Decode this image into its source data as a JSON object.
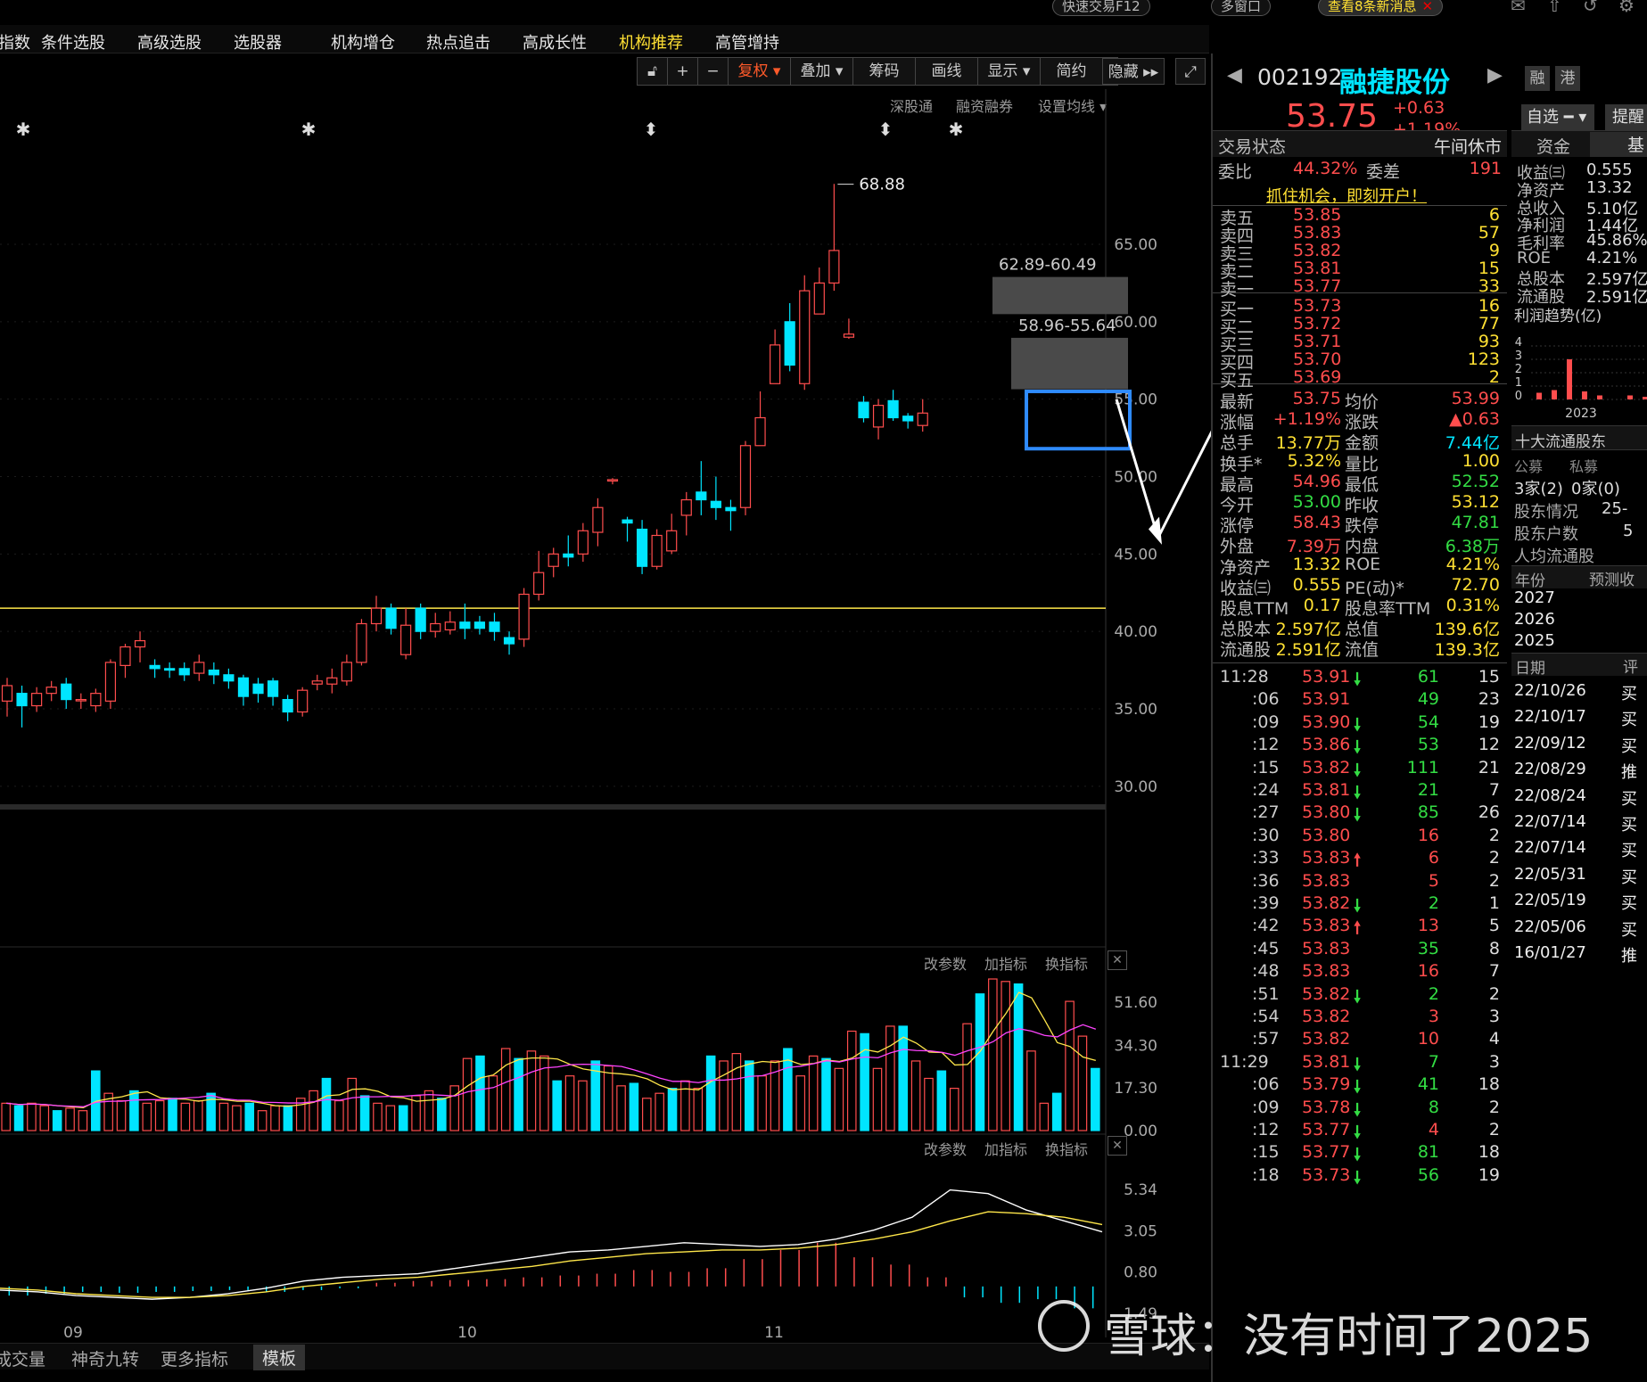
{
  "topbar": {
    "quick_trade": "快速交易F12",
    "multi_window": "多窗口",
    "news": "查看8条新消息"
  },
  "menu": [
    {
      "label": "指数",
      "x": -2
    },
    {
      "label": "条件选股",
      "x": 46
    },
    {
      "label": "高级选股",
      "x": 154
    },
    {
      "label": "选股器",
      "x": 262
    },
    {
      "label": "机构增仓",
      "x": 371
    },
    {
      "label": "热点追击",
      "x": 478
    },
    {
      "label": "高成长性",
      "x": 586
    },
    {
      "label": "机构推荐",
      "x": 694,
      "active": true
    },
    {
      "label": "高管增持",
      "x": 802
    }
  ],
  "chart_tools": [
    "复权",
    "叠加",
    "筹码",
    "画线",
    "显示",
    "简约",
    "隐藏"
  ],
  "chart_sub_links": [
    "深股通",
    "融资融券",
    "设置均线"
  ],
  "indicator_links": [
    "改参数",
    "加指标",
    "换指标"
  ],
  "bottom_tabs": [
    "成交量",
    "神奇九转",
    "更多指标",
    "模板"
  ],
  "chart_data": [
    {
      "type": "candlestick",
      "x_ticks": [
        "09",
        "10",
        "11"
      ],
      "ylim": [
        25.5,
        72.6
      ],
      "y_ticks": [
        "65.00",
        "60.00",
        "55.00",
        "50.00",
        "45.00",
        "40.00",
        "35.00",
        "30.00"
      ],
      "reference_line": 41.5,
      "annotations": {
        "high": "68.88",
        "zone1": "62.89-60.49",
        "zone2": "58.96-55.64"
      },
      "candles": [
        [
          35.5,
          36.5,
          34.5,
          37.0
        ],
        [
          36.0,
          35.2,
          33.8,
          36.5
        ],
        [
          35.2,
          36.0,
          34.8,
          36.4
        ],
        [
          36.0,
          36.4,
          35.5,
          36.8
        ],
        [
          36.6,
          35.6,
          35.0,
          37.0
        ],
        [
          35.6,
          35.6,
          35.0,
          36.0
        ],
        [
          35.2,
          36.0,
          34.8,
          36.3
        ],
        [
          35.5,
          38.0,
          35.0,
          38.2
        ],
        [
          37.8,
          39.0,
          37.0,
          39.2
        ],
        [
          39.0,
          39.4,
          38.0,
          40.0
        ],
        [
          37.8,
          37.6,
          37.0,
          38.2
        ],
        [
          37.6,
          37.5,
          37.0,
          38.0
        ],
        [
          37.6,
          37.2,
          36.8,
          38.0
        ],
        [
          37.3,
          38.0,
          36.8,
          38.5
        ],
        [
          37.5,
          37.2,
          36.6,
          38.0
        ],
        [
          37.2,
          36.8,
          36.3,
          37.6
        ],
        [
          37.0,
          35.8,
          35.2,
          37.2
        ],
        [
          36.6,
          36.0,
          35.4,
          37.0
        ],
        [
          36.8,
          35.8,
          35.2,
          37.0
        ],
        [
          35.6,
          34.8,
          34.2,
          35.9
        ],
        [
          34.8,
          36.2,
          34.5,
          36.4
        ],
        [
          36.6,
          36.8,
          36.2,
          37.2
        ],
        [
          36.6,
          37.0,
          36.0,
          37.6
        ],
        [
          36.8,
          38.0,
          36.5,
          38.5
        ],
        [
          38.0,
          40.5,
          37.8,
          40.8
        ],
        [
          40.5,
          41.5,
          40.0,
          42.3
        ],
        [
          41.5,
          40.2,
          39.8,
          41.8
        ],
        [
          38.5,
          40.4,
          38.2,
          41.5
        ],
        [
          41.5,
          40.0,
          39.5,
          41.8
        ],
        [
          40.0,
          40.5,
          39.6,
          41.2
        ],
        [
          40.1,
          40.6,
          39.8,
          41.3
        ],
        [
          40.6,
          40.2,
          39.5,
          41.8
        ],
        [
          40.6,
          40.2,
          39.8,
          41.0
        ],
        [
          40.6,
          40.0,
          39.4,
          41.2
        ],
        [
          39.6,
          39.2,
          38.5,
          40.0
        ],
        [
          39.5,
          42.4,
          39.0,
          42.8
        ],
        [
          42.4,
          43.8,
          42.0,
          45.2
        ],
        [
          44.2,
          45.0,
          43.5,
          45.4
        ],
        [
          45.0,
          44.8,
          44.2,
          46.2
        ],
        [
          45.0,
          46.5,
          44.5,
          47.0
        ],
        [
          46.4,
          48.0,
          45.5,
          48.6
        ],
        [
          49.8,
          49.8,
          49.5,
          49.9
        ],
        [
          47.2,
          47.0,
          45.8,
          47.4
        ],
        [
          46.6,
          44.2,
          43.7,
          47.2
        ],
        [
          44.2,
          46.2,
          44.0,
          46.6
        ],
        [
          45.2,
          46.5,
          45.0,
          47.6
        ],
        [
          47.5,
          48.5,
          46.2,
          49.0
        ],
        [
          49.0,
          48.5,
          47.5,
          51.0
        ],
        [
          48.4,
          48.0,
          47.2,
          50.0
        ],
        [
          48.0,
          47.8,
          46.5,
          48.5
        ],
        [
          48.0,
          52.0,
          47.5,
          52.3
        ],
        [
          52.0,
          53.8,
          52.5,
          55.5
        ],
        [
          56.0,
          58.5,
          56.5,
          59.5
        ],
        [
          60.0,
          57.2,
          56.8,
          61.2
        ],
        [
          56.0,
          62.0,
          55.6,
          63.0
        ],
        [
          60.5,
          62.5,
          61.0,
          63.5
        ],
        [
          62.5,
          64.6,
          62.0,
          68.9
        ],
        [
          59.0,
          59.2,
          58.9,
          60.2
        ],
        [
          54.8,
          53.8,
          53.5,
          55.2
        ],
        [
          53.2,
          54.6,
          52.4,
          55.0
        ],
        [
          54.9,
          53.8,
          53.6,
          55.6
        ],
        [
          53.9,
          53.6,
          53.1,
          54.1
        ],
        [
          53.3,
          54.1,
          52.9,
          55.0
        ]
      ]
    },
    {
      "type": "bar",
      "ylim": [
        0,
        61
      ],
      "y_ticks": [
        "51.60",
        "34.30",
        "17.30",
        "0.00"
      ],
      "volumes": [
        11,
        10,
        11,
        10,
        8,
        9,
        8,
        24,
        15,
        12,
        16,
        11,
        12,
        13,
        11,
        12,
        15,
        11,
        10,
        11,
        8,
        10,
        10,
        13,
        16,
        21,
        12,
        21,
        14,
        11,
        10,
        10,
        14,
        16,
        13,
        18,
        29,
        30,
        22,
        33,
        29,
        32,
        30,
        20,
        22,
        20,
        28,
        26,
        18,
        19,
        13,
        15,
        17,
        20,
        17,
        30,
        28,
        31,
        28,
        22,
        28,
        33,
        22,
        30,
        29,
        25,
        40,
        39,
        25,
        42,
        42,
        28,
        21,
        24,
        17,
        43,
        55,
        61,
        60,
        59,
        32,
        11,
        15,
        52,
        38,
        25
      ]
    },
    {
      "type": "line",
      "ylim": [
        -2.8,
        6.7
      ],
      "y_ticks": [
        "5.34",
        "3.05",
        "0.80",
        "1.49"
      ],
      "series": [
        {
          "points": [
            -0.2,
            -0.3,
            -0.5,
            -0.6,
            -0.7,
            -0.6,
            -0.4,
            -0.1,
            0.3,
            0.5,
            0.6,
            0.7,
            1.0,
            1.3,
            1.6,
            1.9,
            2.0,
            2.2,
            2.4,
            2.3,
            2.2,
            2.3,
            2.6,
            3.1,
            3.8,
            5.3,
            5.1,
            4.2,
            3.6,
            3.0
          ]
        },
        {
          "points": [
            -0.1,
            -0.2,
            -0.4,
            -0.5,
            -0.6,
            -0.6,
            -0.5,
            -0.3,
            0.0,
            0.2,
            0.4,
            0.5,
            0.7,
            0.9,
            1.1,
            1.4,
            1.6,
            1.8,
            1.9,
            2.0,
            2.0,
            2.1,
            2.3,
            2.6,
            3.0,
            3.6,
            4.1,
            4.0,
            3.8,
            3.4
          ]
        }
      ],
      "macd_bars": [
        -0.5,
        -0.4,
        -0.3,
        -0.35,
        -0.3,
        -0.25,
        -0.2,
        -0.3,
        -0.2,
        -0.1,
        0.2,
        0.3,
        0.35,
        0.4,
        0.5,
        0.6,
        0.7,
        0.9,
        0.8,
        1.0,
        1.5,
        2.0,
        2.4,
        1.6,
        1.2,
        0.5,
        -0.6,
        -0.9,
        -0.7,
        -1.2
      ]
    },
    {
      "type": "bar",
      "title": "利润趋势(亿)",
      "y_ticks": [
        "4",
        "3",
        "2",
        "1",
        "0"
      ],
      "x_ticks": [
        "2023",
        "2"
      ],
      "values": [
        0.5,
        0.7,
        3.0,
        0.6,
        0.3,
        0.0,
        0.3,
        0.2
      ]
    }
  ],
  "stock": {
    "code": "002192",
    "name": "融捷股份",
    "price": "53.75",
    "change": "+0.63",
    "pct": "+1.19%",
    "tag_rong": "融",
    "tag_gang": "港",
    "watch": "自选",
    "remind": "提醒"
  },
  "status": {
    "label": "交易状态",
    "value": "午间休市",
    "wb_label": "委比",
    "wb_value": "44.32%",
    "wc_label": "委差",
    "wc_value": "191",
    "promo": "抓住机会，即刻开户！"
  },
  "asks": [
    {
      "name": "卖五",
      "price": "53.85",
      "vol": "6"
    },
    {
      "name": "卖四",
      "price": "53.83",
      "vol": "57"
    },
    {
      "name": "卖三",
      "price": "53.82",
      "vol": "9"
    },
    {
      "name": "卖二",
      "price": "53.81",
      "vol": "15"
    },
    {
      "name": "卖一",
      "price": "53.77",
      "vol": "33"
    }
  ],
  "bids": [
    {
      "name": "买一",
      "price": "53.73",
      "vol": "16"
    },
    {
      "name": "买二",
      "price": "53.72",
      "vol": "77"
    },
    {
      "name": "买三",
      "price": "53.71",
      "vol": "93"
    },
    {
      "name": "买四",
      "price": "53.70",
      "vol": "123"
    },
    {
      "name": "买五",
      "price": "53.69",
      "vol": "2"
    }
  ],
  "quote": [
    {
      "l1": "最新",
      "v1": "53.75",
      "c1": "red",
      "l2": "均价",
      "v2": "53.99",
      "c2": "red"
    },
    {
      "l1": "涨幅",
      "v1": "+1.19%",
      "c1": "red",
      "l2": "涨跌",
      "v2": "▲0.63",
      "c2": "red"
    },
    {
      "l1": "总手",
      "v1": "13.77万",
      "c1": "yel",
      "l2": "金额",
      "v2": "7.44亿",
      "c2": "cyn"
    },
    {
      "l1": "换手*",
      "v1": "5.32%",
      "c1": "yel",
      "l2": "量比",
      "v2": "1.00",
      "c2": "yel"
    },
    {
      "l1": "最高",
      "v1": "54.96",
      "c1": "red",
      "l2": "最低",
      "v2": "52.52",
      "c2": "grn"
    },
    {
      "l1": "今开",
      "v1": "53.00",
      "c1": "grn",
      "l2": "昨收",
      "v2": "53.12",
      "c2": "yel"
    },
    {
      "l1": "涨停",
      "v1": "58.43",
      "c1": "red",
      "l2": "跌停",
      "v2": "47.81",
      "c2": "grn"
    },
    {
      "l1": "外盘",
      "v1": "7.39万",
      "c1": "red",
      "l2": "内盘",
      "v2": "6.38万",
      "c2": "grn"
    },
    {
      "l1": "净资产",
      "v1": "13.32",
      "c1": "yel",
      "l2": "ROE",
      "v2": "4.21%",
      "c2": "yel"
    },
    {
      "l1": "收益㈢",
      "v1": "0.555",
      "c1": "yel",
      "l2": "PE(动)*",
      "v2": "72.70",
      "c2": "yel"
    },
    {
      "l1": "股息TTM",
      "v1": "0.17",
      "c1": "yel",
      "l2": "股息率TTM",
      "v2": "0.31%",
      "c2": "yel"
    },
    {
      "l1": "总股本",
      "v1": "2.597亿",
      "c1": "yel",
      "l2": "总值",
      "v2": "139.6亿",
      "c2": "yel"
    },
    {
      "l1": "流通股",
      "v1": "2.591亿",
      "c1": "yel",
      "l2": "流值",
      "v2": "139.3亿",
      "c2": "yel"
    }
  ],
  "ticks": [
    {
      "t": "11:28",
      "p": "53.91",
      "d": "dn",
      "v": "61",
      "vc": "grn",
      "n": "15"
    },
    {
      "t": ":06",
      "p": "53.91",
      "d": "",
      "v": "49",
      "vc": "grn",
      "n": "23"
    },
    {
      "t": ":09",
      "p": "53.90",
      "d": "dn",
      "v": "54",
      "vc": "grn",
      "n": "19"
    },
    {
      "t": ":12",
      "p": "53.86",
      "d": "dn",
      "v": "53",
      "vc": "grn",
      "n": "12"
    },
    {
      "t": ":15",
      "p": "53.82",
      "d": "dn",
      "v": "111",
      "vc": "grn",
      "n": "21"
    },
    {
      "t": ":24",
      "p": "53.81",
      "d": "dn",
      "v": "21",
      "vc": "grn",
      "n": "7"
    },
    {
      "t": ":27",
      "p": "53.80",
      "d": "dn",
      "v": "85",
      "vc": "grn",
      "n": "26"
    },
    {
      "t": ":30",
      "p": "53.80",
      "d": "",
      "v": "16",
      "vc": "red",
      "n": "2"
    },
    {
      "t": ":33",
      "p": "53.83",
      "d": "up",
      "v": "6",
      "vc": "red",
      "n": "2"
    },
    {
      "t": ":36",
      "p": "53.83",
      "d": "",
      "v": "5",
      "vc": "red",
      "n": "2"
    },
    {
      "t": ":39",
      "p": "53.82",
      "d": "dn",
      "v": "2",
      "vc": "grn",
      "n": "1"
    },
    {
      "t": ":42",
      "p": "53.83",
      "d": "up",
      "v": "13",
      "vc": "red",
      "n": "5"
    },
    {
      "t": ":45",
      "p": "53.83",
      "d": "",
      "v": "35",
      "vc": "grn",
      "n": "8"
    },
    {
      "t": ":48",
      "p": "53.83",
      "d": "",
      "v": "16",
      "vc": "red",
      "n": "7"
    },
    {
      "t": ":51",
      "p": "53.82",
      "d": "dn",
      "v": "2",
      "vc": "grn",
      "n": "2"
    },
    {
      "t": ":54",
      "p": "53.82",
      "d": "",
      "v": "3",
      "vc": "red",
      "n": "3"
    },
    {
      "t": ":57",
      "p": "53.82",
      "d": "",
      "v": "10",
      "vc": "red",
      "n": "4"
    },
    {
      "t": "11:29",
      "p": "53.81",
      "d": "dn",
      "v": "7",
      "vc": "grn",
      "n": "3"
    },
    {
      "t": ":06",
      "p": "53.79",
      "d": "dn",
      "v": "41",
      "vc": "grn",
      "n": "18"
    },
    {
      "t": ":09",
      "p": "53.78",
      "d": "dn",
      "v": "8",
      "vc": "grn",
      "n": "2"
    },
    {
      "t": ":12",
      "p": "53.77",
      "d": "dn",
      "v": "4",
      "vc": "red",
      "n": "2"
    },
    {
      "t": ":15",
      "p": "53.77",
      "d": "dn",
      "v": "81",
      "vc": "grn",
      "n": "18"
    },
    {
      "t": ":18",
      "p": "53.73",
      "d": "dn",
      "v": "56",
      "vc": "grn",
      "n": "19"
    }
  ],
  "fin": {
    "tab_fund": "资金",
    "tab_basic": "基",
    "items": [
      {
        "l": "收益㈢",
        "v": "0.555"
      },
      {
        "l": "净资产",
        "v": "13.32"
      },
      {
        "l": "总收入",
        "v": "5.10亿"
      },
      {
        "l": "净利润",
        "v": "1.44亿"
      },
      {
        "l": "毛利率",
        "v": "45.86%"
      },
      {
        "l": "ROE",
        "v": "4.21%"
      },
      {
        "l": "总股本",
        "v": "2.597亿"
      },
      {
        "l": "流通股",
        "v": "2.591亿"
      }
    ],
    "top10": "十大流通股东",
    "gm": "公募",
    "pm": "私募",
    "gm_v": "3家(2)",
    "pm_v": "0家(0)",
    "sh": "股东情况",
    "sh_v": "25-",
    "hc": "股东户数",
    "hc_v": "5",
    "avg": "人均流通股",
    "year": "年份",
    "fc": "预测收",
    "years": [
      "2027",
      "2026",
      "2025"
    ],
    "date": "日期",
    "rt": "评",
    "dates": [
      {
        "d": "22/10/26",
        "r": "买"
      },
      {
        "d": "22/10/17",
        "r": "买"
      },
      {
        "d": "22/09/12",
        "r": "买"
      },
      {
        "d": "22/08/29",
        "r": "推"
      },
      {
        "d": "22/08/24",
        "r": "买"
      },
      {
        "d": "22/07/14",
        "r": "买"
      },
      {
        "d": "22/07/14",
        "r": "买"
      },
      {
        "d": "22/05/31",
        "r": "买"
      },
      {
        "d": "22/05/19",
        "r": "买"
      },
      {
        "d": "22/05/06",
        "r": "买"
      },
      {
        "d": "16/01/27",
        "r": "推"
      }
    ]
  },
  "watermark": "雪球：没有时间了2025"
}
